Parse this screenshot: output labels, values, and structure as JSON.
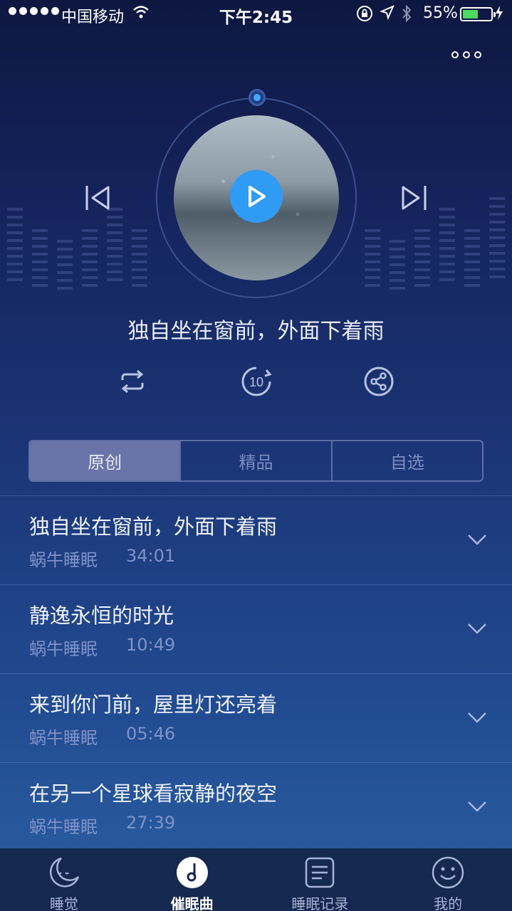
{
  "status_bar": {
    "carrier": "中国移动",
    "time": "下午2:45",
    "battery_percent": "55%",
    "battery_level": 0.55,
    "signal_dots": 5
  },
  "player": {
    "now_playing_title": "独自坐在窗前，外面下着雨",
    "timer_label": "10",
    "state": "paused",
    "progress": 0.0
  },
  "tabs": [
    {
      "label": "原创",
      "active": true
    },
    {
      "label": "精品",
      "active": false
    },
    {
      "label": "自选",
      "active": false
    }
  ],
  "tracks": [
    {
      "title": "独自坐在窗前，外面下着雨",
      "artist": "蜗牛睡眠",
      "duration": "34:01"
    },
    {
      "title": "静逸永恒的时光",
      "artist": "蜗牛睡眠",
      "duration": "10:49"
    },
    {
      "title": "来到你门前，屋里灯还亮着",
      "artist": "蜗牛睡眠",
      "duration": "05:46"
    },
    {
      "title": "在另一个星球看寂静的夜空",
      "artist": "蜗牛睡眠",
      "duration": "27:39"
    }
  ],
  "tab_bar": [
    {
      "label": "睡觉",
      "icon": "moon-icon",
      "active": false
    },
    {
      "label": "催眠曲",
      "icon": "music-note-icon",
      "active": true
    },
    {
      "label": "睡眠记录",
      "icon": "document-icon",
      "active": false
    },
    {
      "label": "我的",
      "icon": "smiley-icon",
      "active": false
    }
  ],
  "colors": {
    "accent": "#2f9bf5",
    "tab_active_bg": "#6a74a8",
    "battery": "#4cd964"
  }
}
